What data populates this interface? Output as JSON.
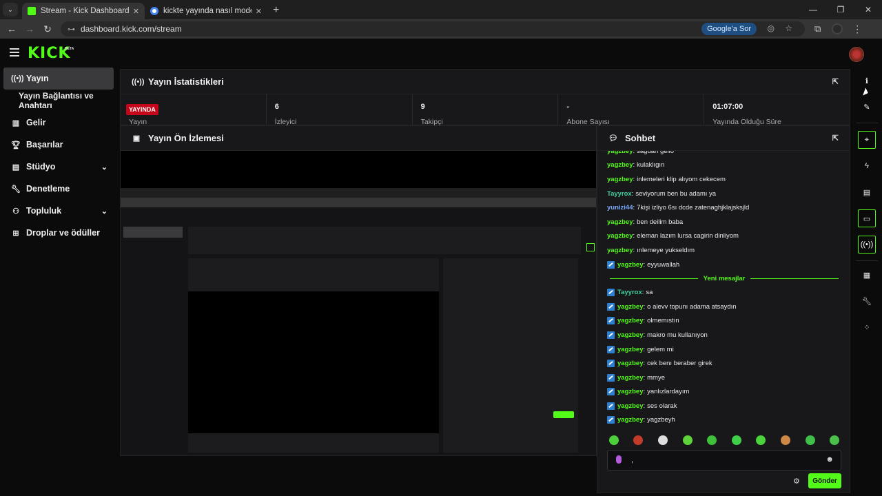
{
  "browser": {
    "tabs": [
      {
        "title": "Stream - Kick Dashboard",
        "active": true
      },
      {
        "title": "kickte yayında nasıl moderatör",
        "active": false
      }
    ],
    "url": "dashboard.kick.com/stream",
    "google_btn": "Google'a Sor"
  },
  "header": {
    "logo": "KICK",
    "beta": "BETA"
  },
  "sidebar": {
    "items": [
      {
        "label": "Yayın",
        "icon": "broadcast-icon"
      },
      {
        "label": "Yayın Bağlantısı ve Anahtarı"
      },
      {
        "label": "Gelir",
        "icon": "chart-icon"
      },
      {
        "label": "Başarılar",
        "icon": "trophy-icon"
      },
      {
        "label": "Stüdyo",
        "icon": "studio-icon"
      },
      {
        "label": "Denetleme",
        "icon": "wrench-icon"
      },
      {
        "label": "Topluluk",
        "icon": "community-icon"
      },
      {
        "label": "Droplar ve ödüller",
        "icon": "gift-icon"
      }
    ]
  },
  "stats": {
    "title": "Yayın İstatistikleri",
    "items": [
      {
        "value": "YAYINDA",
        "label": "Yayın"
      },
      {
        "value": "6",
        "label": "İzleyici"
      },
      {
        "value": "9",
        "label": "Takipçi"
      },
      {
        "value": "-",
        "label": "Abone Sayısı"
      },
      {
        "value": "01:07:00",
        "label": "Yayında Olduğu Süre"
      }
    ]
  },
  "preview": {
    "title": "Yayın Ön İzlemesi"
  },
  "chat": {
    "title": "Sohbet",
    "messages": [
      {
        "user": "yagzbey",
        "text": "sagdan gello",
        "color": "#53fc18",
        "badge": false
      },
      {
        "user": "yagzbey",
        "text": "kulaklıgın",
        "color": "#53fc18",
        "badge": false
      },
      {
        "user": "yagzbey",
        "text": "inlemeleri klip alıyom cekecem",
        "color": "#53fc18",
        "badge": false
      },
      {
        "user": "Tayyrox",
        "text": "seviyorum ben bu adamı ya",
        "color": "#3fd19b",
        "badge": false
      },
      {
        "user": "yunizi44",
        "text": "7kişi izliyo 6sı dcde zatenaghjklajsksjld",
        "color": "#7aa8ff",
        "badge": false
      },
      {
        "user": "yagzbey",
        "text": "ben deilim baba",
        "color": "#53fc18",
        "badge": false
      },
      {
        "user": "yagzbey",
        "text": "eleman lazım lursa cagirin dinliyom",
        "color": "#53fc18",
        "badge": false
      },
      {
        "user": "yagzbey",
        "text": "ınlemeye yukseldım",
        "color": "#53fc18",
        "badge": false
      },
      {
        "user": "yagzbey",
        "text": "eyyuwallah",
        "color": "#53fc18",
        "badge": true
      }
    ],
    "new_messages_label": "Yeni mesajlar",
    "new_messages": [
      {
        "user": "Tayyrox",
        "text": "sa",
        "color": "#3fd19b"
      },
      {
        "user": "yagzbey",
        "text": "o alevv topunı adama atsaydın",
        "color": "#53fc18"
      },
      {
        "user": "yagzbey",
        "text": "olmemıstın",
        "color": "#53fc18"
      },
      {
        "user": "yagzbey",
        "text": "makro mu kullanıyon",
        "color": "#53fc18"
      },
      {
        "user": "yagzbey",
        "text": "gelem mi",
        "color": "#53fc18"
      },
      {
        "user": "yagzbey",
        "text": "cek benı beraber girek",
        "color": "#53fc18"
      },
      {
        "user": "yagzbey",
        "text": "mmye",
        "color": "#53fc18"
      },
      {
        "user": "yagzbey",
        "text": "yanlızlardayım",
        "color": "#53fc18"
      },
      {
        "user": "yagzbey",
        "text": "ses olarak",
        "color": "#53fc18"
      },
      {
        "user": "yagzbey",
        "text": "yagzbeyh",
        "color": "#53fc18"
      }
    ],
    "input_value": ",",
    "send_label": "Gönder",
    "emote_colors": [
      "#4ccf3a",
      "#c23a2a",
      "#ddd",
      "#5fd43a",
      "#3fbf3a",
      "#3fcf4a",
      "#4ad43a",
      "#c84",
      "#3fbf4a",
      "#4ac04a"
    ]
  },
  "accent": "#53fc18"
}
